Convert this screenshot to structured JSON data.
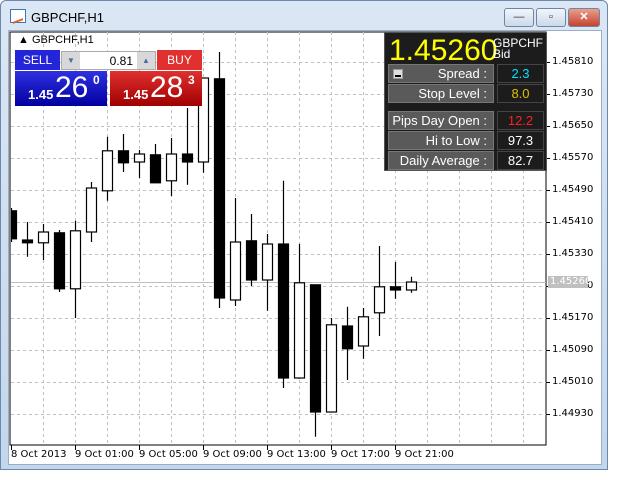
{
  "window": {
    "title": "GBPCHF,H1",
    "minimize": "—",
    "maximize": "▫",
    "close": "✕"
  },
  "chart_label": "GBPCHF,H1",
  "trade": {
    "sell_label": "SELL",
    "buy_label": "BUY",
    "lot": "0.81",
    "sell": {
      "prefix": "1.45",
      "big": "26",
      "sup": "0"
    },
    "buy": {
      "prefix": "1.45",
      "big": "28",
      "sup": "3"
    }
  },
  "info_panel": {
    "price": "1.45260",
    "symbol": "GBPCHF",
    "side": "Bid",
    "rows": [
      {
        "label": "Spread :",
        "value": "2.3",
        "color": "#00e0ff"
      },
      {
        "label": "Stop Level :",
        "value": "8.0",
        "color": "#e0c000"
      },
      {
        "label": "Pips Day Open :",
        "value": "12.2",
        "color": "#ff2020"
      },
      {
        "label": "Hi to Low :",
        "value": "97.3",
        "color": "#ffffff"
      },
      {
        "label": "Daily Average :",
        "value": "82.7",
        "color": "#ffffff"
      }
    ]
  },
  "chart_data": {
    "type": "candlestick",
    "symbol": "GBPCHF",
    "timeframe": "H1",
    "ylim": [
      1.4486,
      1.4589
    ],
    "y_ticks": [
      "1.45810",
      "1.45730",
      "1.45650",
      "1.45570",
      "1.45490",
      "1.45410",
      "1.45330",
      "1.45250",
      "1.45170",
      "1.45090",
      "1.45010",
      "1.44930"
    ],
    "x_ticks": [
      "8 Oct 2013",
      "9 Oct 01:00",
      "9 Oct 05:00",
      "9 Oct 09:00",
      "9 Oct 13:00",
      "9 Oct 17:00",
      "9 Oct 21:00"
    ],
    "current_price": "1.45260",
    "candles": [
      [
        1.45438,
        1.45445,
        1.4536,
        1.45368
      ],
      [
        1.45365,
        1.4541,
        1.45323,
        1.45358
      ],
      [
        1.45358,
        1.45405,
        1.45315,
        1.45385
      ],
      [
        1.45383,
        1.4539,
        1.45235,
        1.45243
      ],
      [
        1.45243,
        1.45413,
        1.4517,
        1.45388
      ],
      [
        1.45385,
        1.4551,
        1.4536,
        1.45495
      ],
      [
        1.45488,
        1.45623,
        1.45463,
        1.45588
      ],
      [
        1.45588,
        1.4563,
        1.45535,
        1.45558
      ],
      [
        1.4556,
        1.4559,
        1.4552,
        1.4558
      ],
      [
        1.45578,
        1.45605,
        1.45508,
        1.45508
      ],
      [
        1.45513,
        1.4562,
        1.45475,
        1.4558
      ],
      [
        1.4558,
        1.45695,
        1.45503,
        1.4556
      ],
      [
        1.4556,
        1.4577,
        1.45533,
        1.4577
      ],
      [
        1.45768,
        1.45835,
        1.45195,
        1.4522
      ],
      [
        1.45215,
        1.4547,
        1.452,
        1.4536
      ],
      [
        1.45363,
        1.4543,
        1.4525,
        1.45265
      ],
      [
        1.45265,
        1.4538,
        1.45188,
        1.45355
      ],
      [
        1.45355,
        1.45513,
        1.44995,
        1.4502
      ],
      [
        1.4502,
        1.45355,
        1.45018,
        1.45258
      ],
      [
        1.45253,
        1.45253,
        1.44873,
        1.44935
      ],
      [
        1.44935,
        1.4517,
        1.44935,
        1.45153
      ],
      [
        1.4515,
        1.45198,
        1.45015,
        1.45093
      ],
      [
        1.451,
        1.45195,
        1.45068,
        1.45173
      ],
      [
        1.45183,
        1.4535,
        1.45125,
        1.45248
      ],
      [
        1.45248,
        1.4531,
        1.45218,
        1.4524
      ],
      [
        1.4524,
        1.45273,
        1.45233,
        1.4526
      ]
    ]
  }
}
